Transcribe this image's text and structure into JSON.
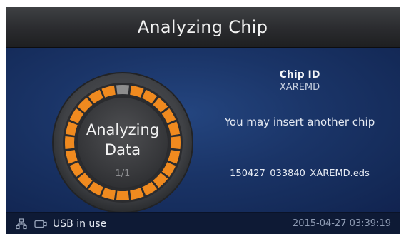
{
  "header": {
    "title": "Analyzing Chip"
  },
  "progress": {
    "status_line1": "Analyzing",
    "status_line2": "Data",
    "count": "1/1",
    "total_segments": 24,
    "completed_segments": 23,
    "colors": {
      "done": "#f08a1f",
      "pending": "#8d8d8d"
    }
  },
  "chip": {
    "id_label": "Chip ID",
    "id_value": "XAREMD",
    "message": "You may insert another chip",
    "filename": "150427_033840_XAREMD.eds"
  },
  "status_bar": {
    "network_icon": "network-icon",
    "usb_icon": "usb-icon",
    "usb_label": "USB in use",
    "datetime": "2015-04-27 03:39:19"
  }
}
